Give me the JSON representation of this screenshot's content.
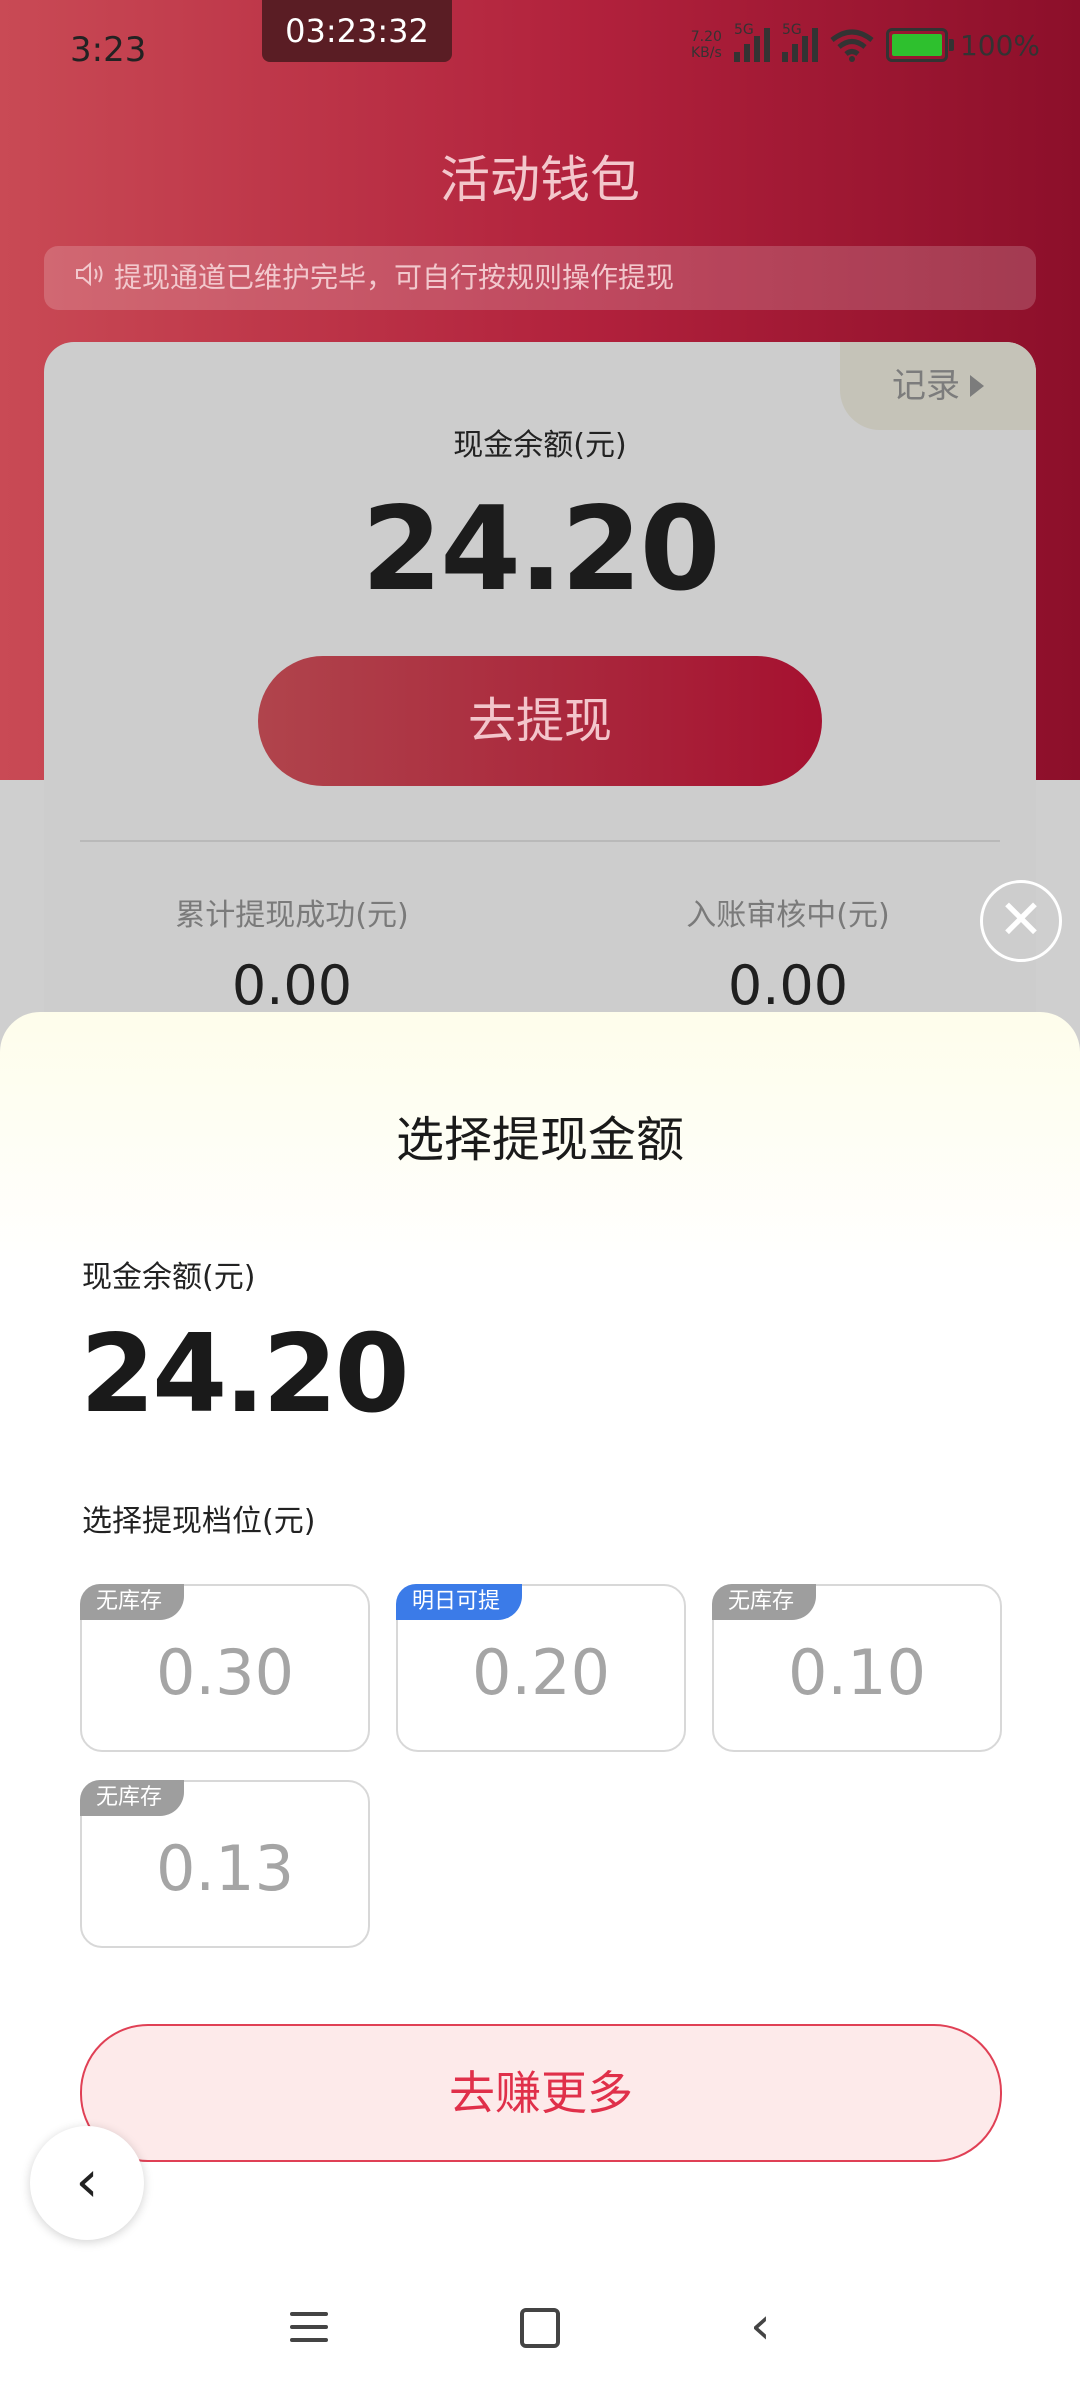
{
  "status_bar": {
    "time": "3:23",
    "clock": "03:23:32",
    "net_speed": "7.20",
    "net_unit": "KB/s",
    "sim1": "5G",
    "sim2": "5G",
    "battery": "100%"
  },
  "page": {
    "title": "活动钱包",
    "notice": "提现通道已维护完毕，可自行按规则操作提现"
  },
  "card": {
    "record_label": "记录",
    "balance_label": "现金余额(元)",
    "balance": "24.20",
    "withdraw_button": "去提现",
    "stats": [
      {
        "label": "累计提现成功(元)",
        "value": "0.00"
      },
      {
        "label": "入账审核中(元)",
        "value": "0.00"
      }
    ]
  },
  "sheet": {
    "title": "选择提现金额",
    "balance_label": "现金余额(元)",
    "balance": "24.20",
    "tier_label": "选择提现档位(元)",
    "options": [
      {
        "tag": "无库存",
        "value": "0.30",
        "tag_color": "#9e9e9e"
      },
      {
        "tag": "明日可提",
        "value": "0.20",
        "tag_color": "#3b7be8"
      },
      {
        "tag": "无库存",
        "value": "0.10",
        "tag_color": "#9e9e9e"
      },
      {
        "tag": "无库存",
        "value": "0.13",
        "tag_color": "#9e9e9e"
      }
    ],
    "earn_more_button": "去赚更多"
  },
  "icons": {
    "close": "close-icon",
    "back": "chevron-left-icon",
    "speaker": "speaker-icon"
  }
}
